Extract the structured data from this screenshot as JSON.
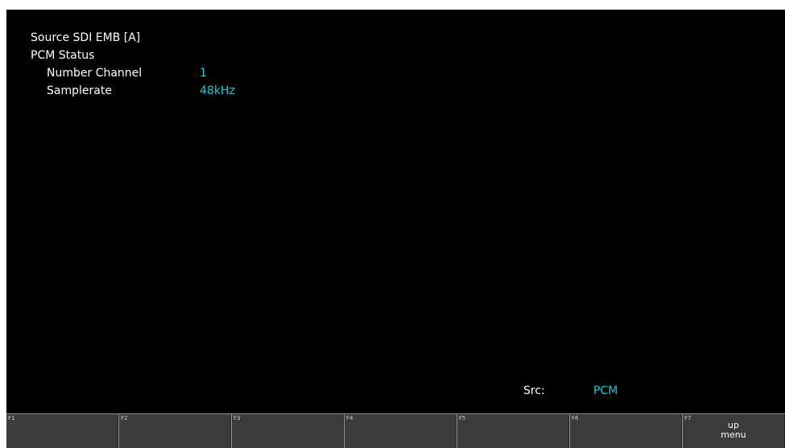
{
  "status": {
    "source": "Source SDI EMB [A]",
    "section": "PCM Status",
    "fields": [
      {
        "label": "Number Channel",
        "value": "1"
      },
      {
        "label": "Samplerate",
        "value": "48kHz"
      }
    ],
    "src_label": "Src:",
    "src_value": "PCM"
  },
  "fkeys": [
    {
      "key": "F1",
      "line1": "",
      "line2": ""
    },
    {
      "key": "F2",
      "line1": "",
      "line2": ""
    },
    {
      "key": "F3",
      "line1": "",
      "line2": ""
    },
    {
      "key": "F4",
      "line1": "",
      "line2": ""
    },
    {
      "key": "F5",
      "line1": "",
      "line2": ""
    },
    {
      "key": "F6",
      "line1": "",
      "line2": ""
    },
    {
      "key": "F7",
      "line1": "up",
      "line2": "menu"
    }
  ],
  "colors": {
    "background": "#000000",
    "value": "#19c9d6",
    "text": "#ffffff",
    "fkey": "#3b3b3b"
  }
}
